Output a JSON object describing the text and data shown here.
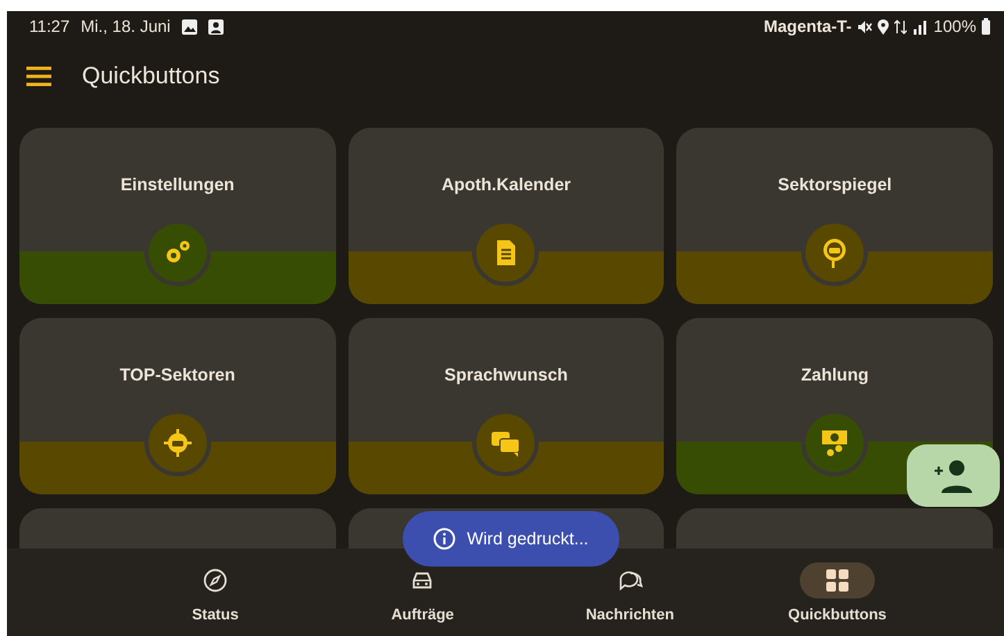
{
  "status_bar": {
    "time": "11:27",
    "date": "Mi., 18. Juni",
    "carrier": "Magenta-T-",
    "battery": "100%"
  },
  "app_bar": {
    "title": "Quickbuttons"
  },
  "tiles": [
    {
      "kind": "full",
      "label": "Einstellungen",
      "color": "#384d04"
    },
    {
      "kind": "full",
      "label": "Apoth.Kalender",
      "color": "#584800"
    },
    {
      "kind": "full",
      "label": "Sektorspiegel",
      "color": "#584800"
    },
    {
      "kind": "full",
      "label": "TOP-Sektoren",
      "color": "#584800"
    },
    {
      "kind": "full",
      "label": "Sprachwunsch",
      "color": "#584800"
    },
    {
      "kind": "full",
      "label": "Zahlung",
      "color": "#384d04"
    },
    {
      "kind": "partial"
    },
    {
      "kind": "partial"
    },
    {
      "kind": "partial"
    }
  ],
  "toast": {
    "text": "Wird gedruckt..."
  },
  "bottom_nav": [
    {
      "label": "Status",
      "selected": false
    },
    {
      "label": "Aufträge",
      "selected": false
    },
    {
      "label": "Nachrichten",
      "selected": false
    },
    {
      "label": "Quickbuttons",
      "selected": true
    }
  ]
}
